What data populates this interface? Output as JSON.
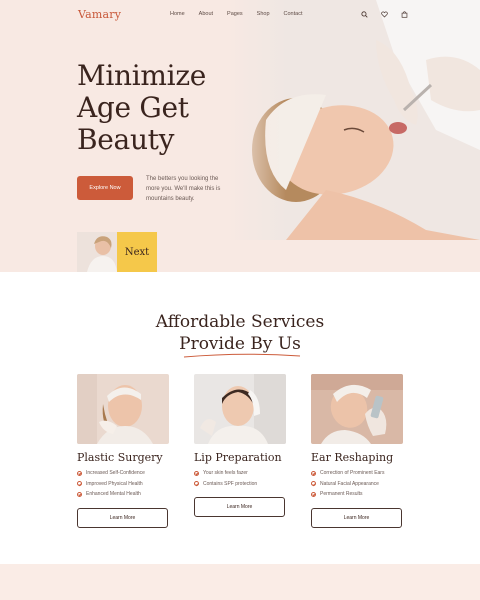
{
  "brand": {
    "logo": "Vamary",
    "accent": "#cc5b3a",
    "highlight": "#f5c84a"
  },
  "nav": {
    "items": [
      "Home",
      "About",
      "Pages",
      "Shop",
      "Contact"
    ],
    "icons": [
      "search-icon",
      "heart-icon",
      "bag-icon"
    ]
  },
  "hero": {
    "title_lines": [
      "Minimize",
      "Age Get",
      "Beauty"
    ],
    "cta": "Explore Now",
    "description": "The betters you looking the more you. We'll make this is mountains beauty.",
    "next_label": "Next"
  },
  "services": {
    "title_line1": "Affordable Services",
    "title_line2": "Provide By Us",
    "cards": [
      {
        "title": "Plastic Surgery",
        "items": [
          "Increased Self-Confidence",
          "Improved Physical Health",
          "Enhanced Mental Health"
        ],
        "button": "Learn More"
      },
      {
        "title": "Lip Preparation",
        "items": [
          "Your skin feels fazer",
          "Contains SPF protection"
        ],
        "button": "Learn More"
      },
      {
        "title": "Ear Reshaping",
        "items": [
          "Correction of Prominent Ears",
          "Natural Facial Appearance",
          "Permanent Results"
        ],
        "button": "Learn More"
      }
    ]
  }
}
